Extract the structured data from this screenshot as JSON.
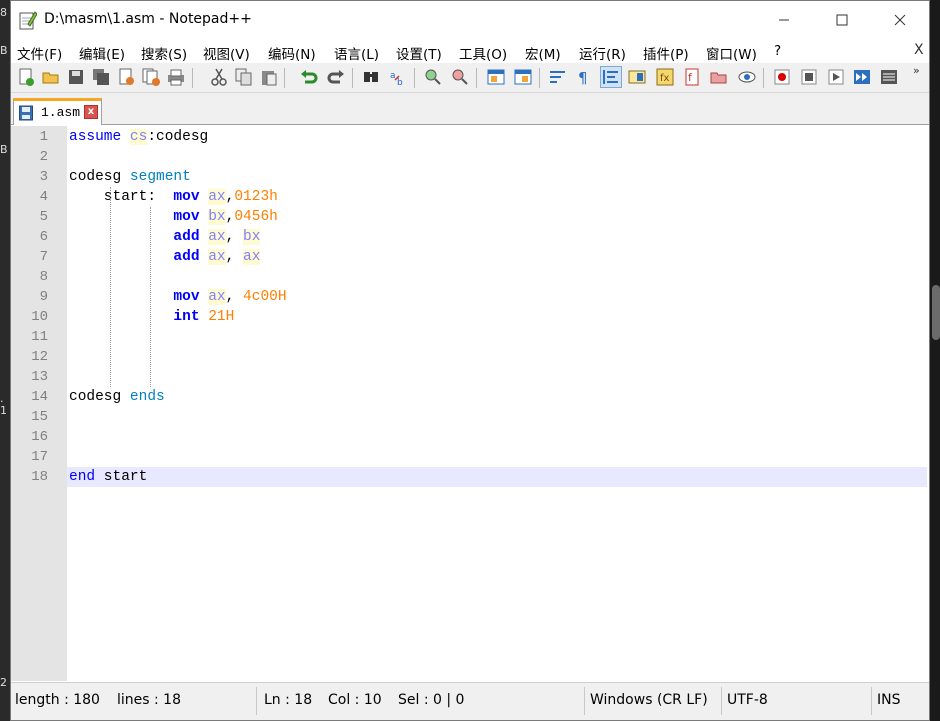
{
  "window": {
    "title": "D:\\masm\\1.asm - Notepad++"
  },
  "desktop": {
    "left_glyphs": [
      "8",
      "B",
      "B",
      ".",
      "1",
      "2"
    ]
  },
  "menu": {
    "items": [
      "文件(F)",
      "编辑(E)",
      "搜索(S)",
      "视图(V)",
      "编码(N)",
      "语言(L)",
      "设置(T)",
      "工具(O)",
      "宏(M)",
      "运行(R)",
      "插件(P)",
      "窗口(W)",
      "?"
    ],
    "close_label": "X"
  },
  "toolbar": {
    "buttons": [
      "new-file-icon",
      "open-file-icon",
      "save-icon",
      "save-all-icon",
      "close-icon",
      "close-all-icon",
      "print-icon",
      "cut-icon",
      "copy-icon",
      "paste-icon",
      "undo-icon",
      "redo-icon",
      "find-icon",
      "replace-icon",
      "zoom-in-icon",
      "zoom-out-icon",
      "sync-vertical-icon",
      "sync-horizontal-icon",
      "word-wrap-icon",
      "show-all-chars-icon",
      "indent-guide-icon",
      "doc-map-icon",
      "function-list-icon",
      "folder-workspace-icon",
      "monitoring-icon",
      "record-macro-icon",
      "stop-macro-icon",
      "play-macro-icon",
      "run-macro-multiple-icon",
      "save-macro-icon"
    ],
    "active": "indent-guide-icon",
    "more_label": "»"
  },
  "tabs": [
    {
      "label": "1.asm",
      "close_label": "x"
    }
  ],
  "editor": {
    "current_line": 18,
    "lines": [
      {
        "n": "1",
        "tokens": [
          {
            "t": "assume",
            "c": "kw"
          },
          {
            "t": " ",
            "c": "id"
          },
          {
            "t": "cs",
            "c": "reg"
          },
          {
            "t": ":codesg",
            "c": "id"
          }
        ]
      },
      {
        "n": "2",
        "tokens": []
      },
      {
        "n": "3",
        "tokens": [
          {
            "t": "codesg ",
            "c": "id"
          },
          {
            "t": "segment",
            "c": "seg"
          }
        ]
      },
      {
        "n": "4",
        "tokens": [
          {
            "t": "    start:  ",
            "c": "id"
          },
          {
            "t": "mov",
            "c": "ins"
          },
          {
            "t": " ",
            "c": "id"
          },
          {
            "t": "ax",
            "c": "reg"
          },
          {
            "t": ",",
            "c": "id"
          },
          {
            "t": "0123h",
            "c": "num"
          }
        ]
      },
      {
        "n": "5",
        "tokens": [
          {
            "t": "            ",
            "c": "id"
          },
          {
            "t": "mov",
            "c": "ins"
          },
          {
            "t": " ",
            "c": "id"
          },
          {
            "t": "bx",
            "c": "reg"
          },
          {
            "t": ",",
            "c": "id"
          },
          {
            "t": "0456h",
            "c": "num"
          }
        ]
      },
      {
        "n": "6",
        "tokens": [
          {
            "t": "            ",
            "c": "id"
          },
          {
            "t": "add",
            "c": "ins"
          },
          {
            "t": " ",
            "c": "id"
          },
          {
            "t": "ax",
            "c": "reg"
          },
          {
            "t": ", ",
            "c": "id"
          },
          {
            "t": "bx",
            "c": "reg"
          }
        ]
      },
      {
        "n": "7",
        "tokens": [
          {
            "t": "            ",
            "c": "id"
          },
          {
            "t": "add",
            "c": "ins"
          },
          {
            "t": " ",
            "c": "id"
          },
          {
            "t": "ax",
            "c": "reg"
          },
          {
            "t": ", ",
            "c": "id"
          },
          {
            "t": "ax",
            "c": "reg"
          }
        ]
      },
      {
        "n": "8",
        "tokens": []
      },
      {
        "n": "9",
        "tokens": [
          {
            "t": "            ",
            "c": "id"
          },
          {
            "t": "mov",
            "c": "ins"
          },
          {
            "t": " ",
            "c": "id"
          },
          {
            "t": "ax",
            "c": "reg"
          },
          {
            "t": ", ",
            "c": "id"
          },
          {
            "t": "4c00H",
            "c": "num"
          }
        ]
      },
      {
        "n": "10",
        "tokens": [
          {
            "t": "            ",
            "c": "id"
          },
          {
            "t": "int",
            "c": "ins"
          },
          {
            "t": " ",
            "c": "id"
          },
          {
            "t": "21H",
            "c": "num"
          }
        ]
      },
      {
        "n": "11",
        "tokens": []
      },
      {
        "n": "12",
        "tokens": []
      },
      {
        "n": "13",
        "tokens": []
      },
      {
        "n": "14",
        "tokens": [
          {
            "t": "codesg ",
            "c": "id"
          },
          {
            "t": "ends",
            "c": "seg"
          }
        ]
      },
      {
        "n": "15",
        "tokens": []
      },
      {
        "n": "16",
        "tokens": []
      },
      {
        "n": "17",
        "tokens": []
      },
      {
        "n": "18",
        "tokens": [
          {
            "t": "end",
            "c": "kw"
          },
          {
            "t": " start",
            "c": "id"
          }
        ]
      }
    ]
  },
  "status": {
    "length": "length : 180",
    "lines": "lines : 18",
    "ln": "Ln : 18",
    "col": "Col : 10",
    "sel": "Sel : 0 | 0",
    "eol": "Windows (CR LF)",
    "encoding": "UTF-8",
    "mode": "INS"
  },
  "colors": {
    "keyword": "#0000ff",
    "segment": "#0080c0",
    "register": "#8080ff",
    "number": "#ff8000",
    "current_line": "#e8e8ff",
    "tab_accent": "#f5a623"
  }
}
